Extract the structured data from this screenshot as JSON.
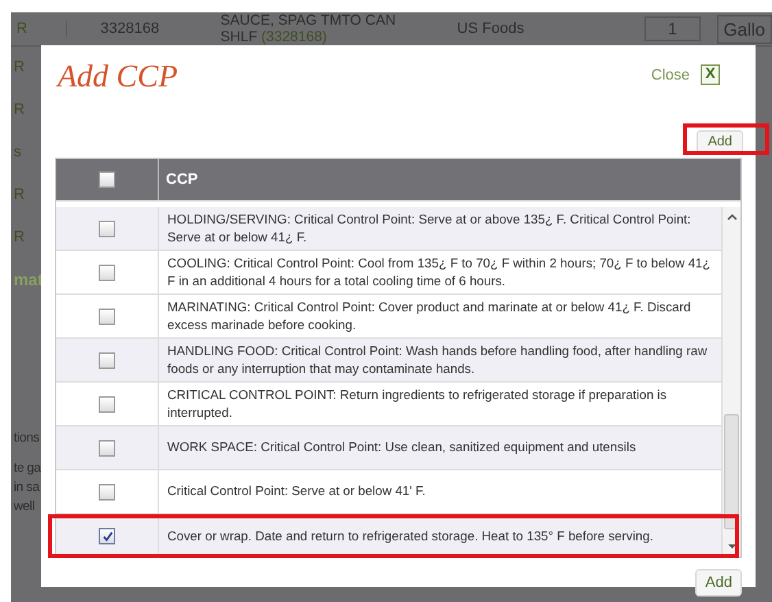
{
  "background": {
    "top_row": {
      "marker": "R",
      "number": "3328168",
      "item": "SAUCE, SPAG TMTO CAN SHLF",
      "item_code": "(3328168)",
      "vendor": "US Foods",
      "quantity": "1",
      "unit": "Gallo"
    },
    "side_texts": [
      "R",
      "R",
      "s",
      "R",
      "R",
      "mat"
    ],
    "side_heading": "tions",
    "side_lines": [
      "te ga",
      "in sa",
      "well"
    ]
  },
  "modal": {
    "title": "Add CCP",
    "close_label": "Close",
    "close_icon": "X",
    "top_add": {
      "label": "Add",
      "highlighted": true
    },
    "bottom_add": {
      "label": "Add",
      "highlighted": false
    }
  },
  "table": {
    "header_checkbox": {
      "checked": false
    },
    "columns": [
      "CCP"
    ],
    "rows": [
      {
        "text": "HOLDING/SERVING: Critical Control Point: Serve at or above 135¿ F. Critical Control Point: Serve at or below 41¿ F.",
        "checked": false,
        "highlighted": false
      },
      {
        "text": "COOLING: Critical Control Point: Cool from 135¿ F to 70¿ F within 2 hours; 70¿ F to below 41¿ F in an additional 4 hours for a total cooling time of 6 hours.",
        "checked": false,
        "highlighted": false
      },
      {
        "text": "MARINATING: Critical Control Point: Cover product and marinate at or below 41¿ F. Discard excess marinade before cooking.",
        "checked": false,
        "highlighted": false
      },
      {
        "text": "HANDLING FOOD: Critical Control Point: Wash hands before handling food, after handling raw foods or any interruption that may contaminate hands.",
        "checked": false,
        "highlighted": false
      },
      {
        "text": "CRITICAL CONTROL POINT: Return ingredients to refrigerated storage if preparation is interrupted.",
        "checked": false,
        "highlighted": false
      },
      {
        "text": "WORK SPACE: Critical Control Point: Use clean, sanitized equipment and utensils",
        "checked": false,
        "highlighted": false
      },
      {
        "text": "Critical Control Point: Serve at or below 41' F.",
        "checked": false,
        "highlighted": false
      },
      {
        "text": "Cover or wrap. Date and return to refrigerated storage. Heat to 135° F before serving.",
        "checked": true,
        "highlighted": true
      }
    ]
  }
}
